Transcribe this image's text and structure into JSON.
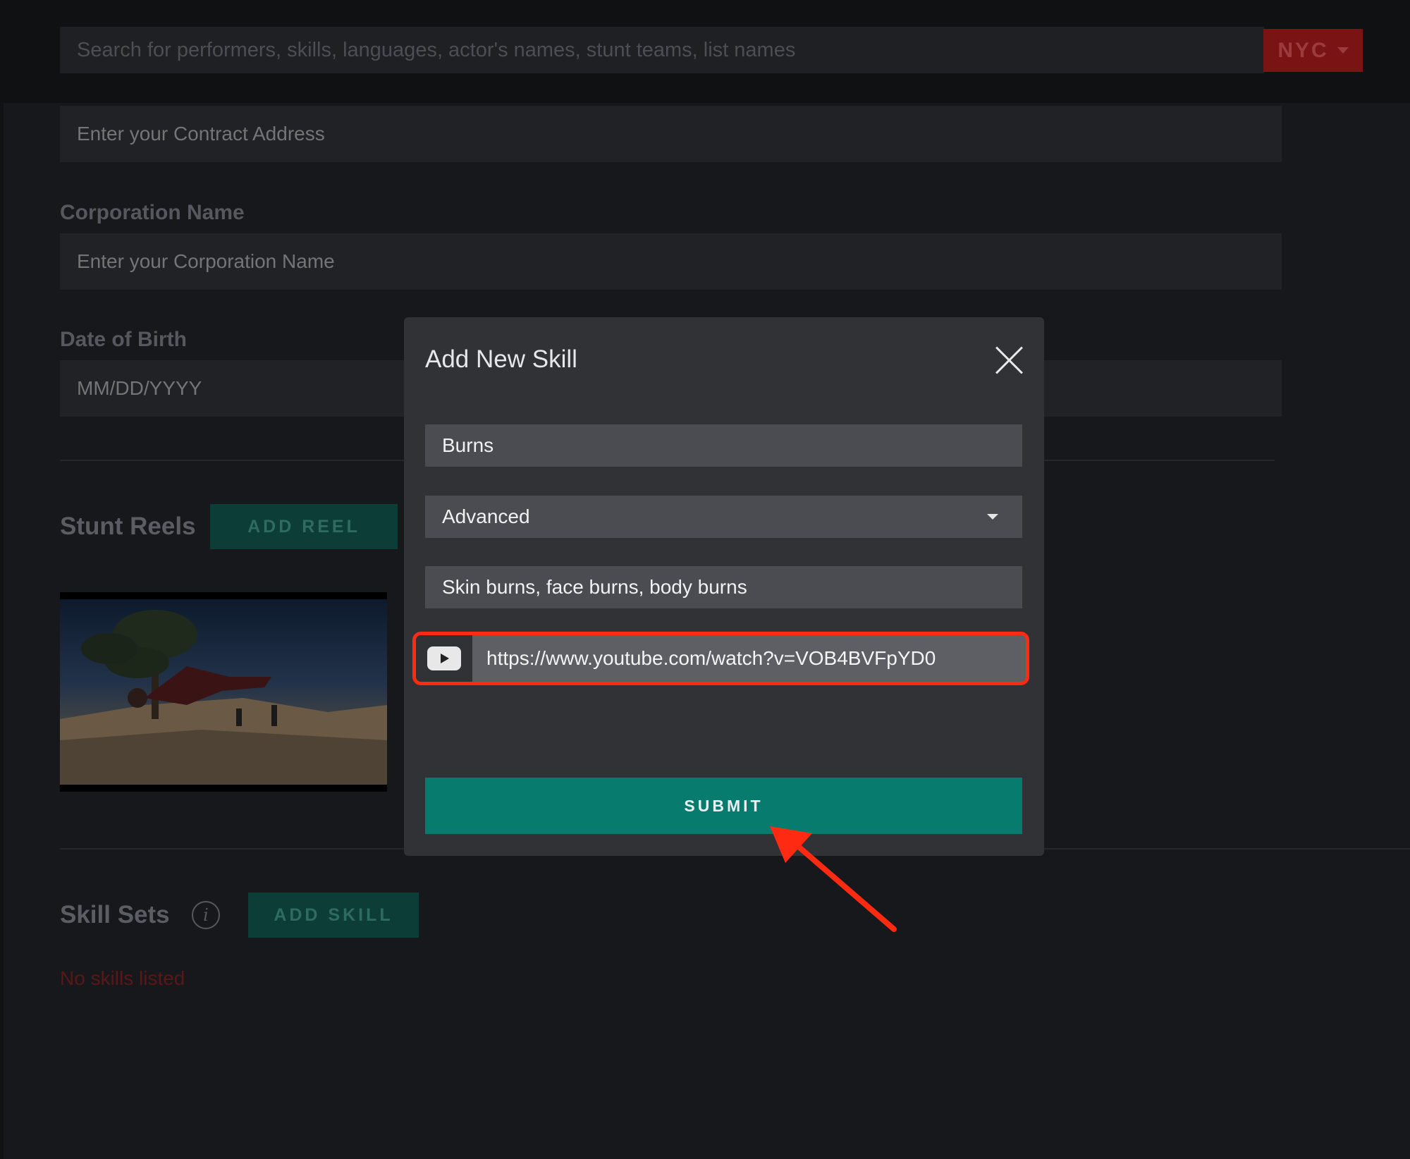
{
  "header": {
    "search_placeholder": "Search for performers, skills, languages, actor's names, stunt teams, list names",
    "city": "NYC"
  },
  "form": {
    "contract_address_placeholder": "Enter your Contract Address",
    "corporation_label": "Corporation Name",
    "corporation_placeholder": "Enter your Corporation Name",
    "dob_label": "Date of Birth",
    "dob_placeholder": "MM/DD/YYYY"
  },
  "stunt_reels": {
    "title": "Stunt Reels",
    "add_label": "ADD REEL"
  },
  "skill_sets": {
    "title": "Skill Sets",
    "info_glyph": "i",
    "add_label": "ADD SKILL",
    "empty_text": "No skills listed"
  },
  "modal": {
    "title": "Add New Skill",
    "skill_value": "Burns",
    "level_value": "Advanced",
    "description_value": "Skin burns, face burns, body burns",
    "video_url": "https://www.youtube.com/watch?v=VOB4BVFpYD0",
    "submit_label": "SUBMIT"
  },
  "colors": {
    "accent_green": "#077b6d",
    "highlight_red": "#ff2a12",
    "city_red": "#7a1414"
  },
  "icons": [
    "caret-down-icon",
    "close-icon",
    "youtube-icon",
    "info-icon",
    "arrow-annotation-icon"
  ]
}
